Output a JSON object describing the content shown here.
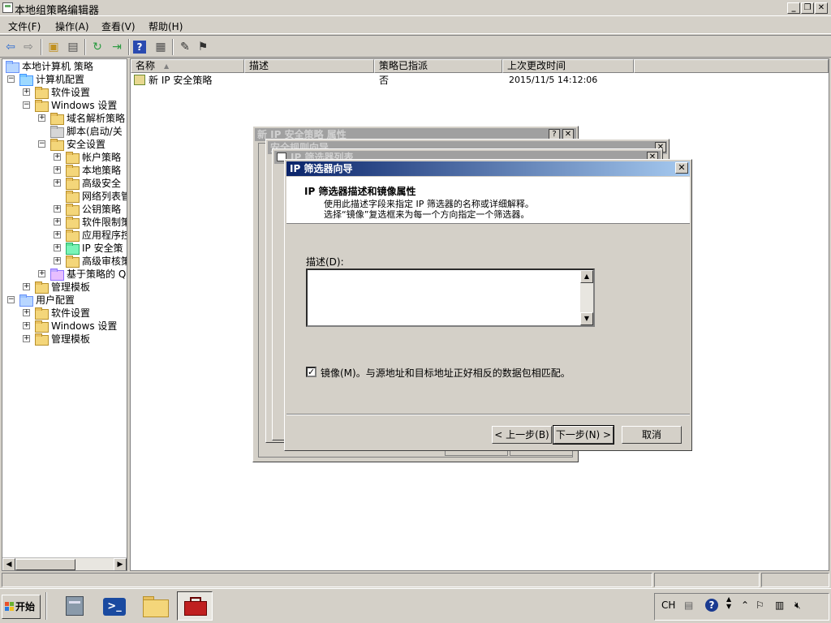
{
  "window": {
    "title": "本地组策略编辑器",
    "controls": {
      "minimize": "_",
      "restore": "❐",
      "close": "✕"
    }
  },
  "menu": {
    "file": "文件(F)",
    "action": "操作(A)",
    "view": "查看(V)",
    "help": "帮助(H)"
  },
  "toolbar": {
    "icons": [
      "back-arrow-icon",
      "forward-arrow-icon",
      "up-folder-icon",
      "show-hide-tree-icon",
      "refresh-icon",
      "export-list-icon",
      "help-icon",
      "properties-icon",
      "manage-filter-icon",
      "assign-icon"
    ]
  },
  "tree": {
    "items": [
      {
        "label": "本地计算机 策略"
      },
      {
        "label": "计算机配置"
      },
      {
        "label": "软件设置"
      },
      {
        "label": "Windows 设置"
      },
      {
        "label": "域名解析策略"
      },
      {
        "label": "脚本(启动/关"
      },
      {
        "label": "安全设置"
      },
      {
        "label": "帐户策略"
      },
      {
        "label": "本地策略"
      },
      {
        "label": "高级安全"
      },
      {
        "label": "网络列表管"
      },
      {
        "label": "公钥策略"
      },
      {
        "label": "软件限制策"
      },
      {
        "label": "应用程序控"
      },
      {
        "label": "IP 安全策"
      },
      {
        "label": "高级审核策"
      },
      {
        "label": "基于策略的 Q"
      },
      {
        "label": "管理模板"
      },
      {
        "label": "用户配置"
      },
      {
        "label": "软件设置"
      },
      {
        "label": "Windows 设置"
      },
      {
        "label": "管理模板"
      }
    ]
  },
  "list": {
    "columns": [
      "名称",
      "描述",
      "策略已指派",
      "上次更改时间"
    ],
    "sort_indicator": "▲",
    "rows": [
      {
        "name": "新 IP 安全策略",
        "description": "",
        "assigned": "否",
        "modified": "2015/11/5 14:12:06"
      }
    ]
  },
  "bg_dialogs": {
    "properties_title": "新 IP 安全策略 属性",
    "rules_title": "安全规则向导",
    "filter_list_title": "IP 筛选器列表"
  },
  "wizard": {
    "title": "IP 筛选器向导",
    "header_title": "IP 筛选器描述和镜像属性",
    "header_line1": "使用此描述字段来指定 IP 筛选器的名称或详细解释。",
    "header_line2": "选择“镜像”复选框来为每一个方向指定一个筛选器。",
    "description_label": "描述(D):",
    "description_value": "",
    "mirror_checked": true,
    "mirror_label": "镜像(M)。与源地址和目标地址正好相反的数据包相匹配。",
    "back_button": "< 上一步(B)",
    "next_button": "下一步(N) >",
    "cancel_button": "取消"
  },
  "taskbar": {
    "start_label": "开始",
    "apps": [
      "server-manager-icon",
      "powershell-icon",
      "explorer-folder-icon",
      "toolbox-icon"
    ],
    "tray": {
      "language": "CH",
      "icons": [
        "keyboard-icon",
        "help-circle-icon",
        "show-hidden-icons-icon",
        "flag-icon",
        "network-icon",
        "volume-muted-icon"
      ]
    }
  },
  "colors": {
    "title_active_start": "#0a246a",
    "title_active_end": "#a6caf0",
    "face": "#d4d0c8"
  }
}
